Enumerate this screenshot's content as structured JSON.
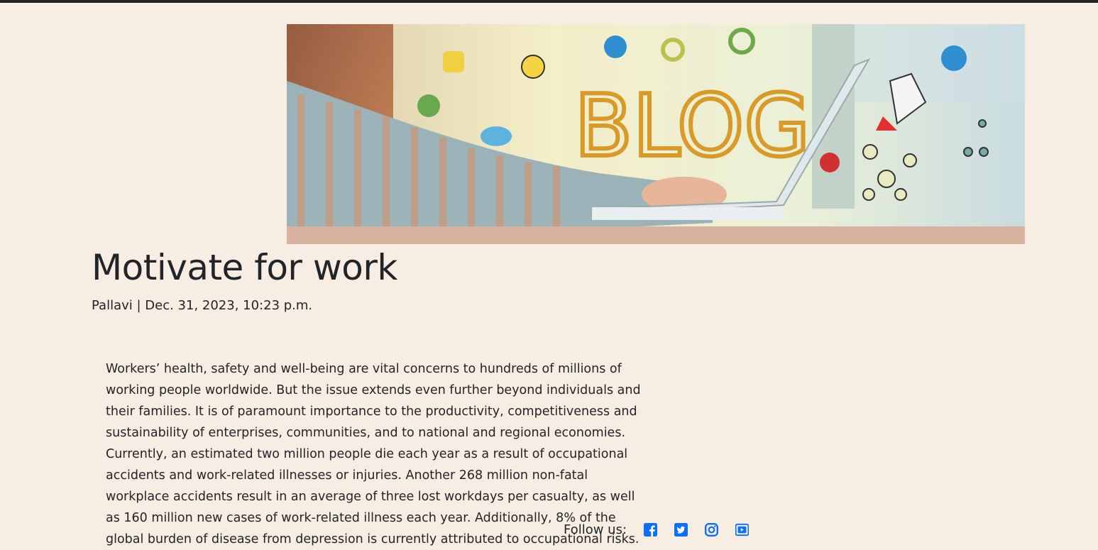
{
  "hero": {
    "image_alt": "Blog banner",
    "banner_text": "BLOG"
  },
  "post": {
    "title": "Motivate for work",
    "meta": "Pallavi | Dec. 31, 2023, 10:23 p.m.",
    "body": "Workers’ health, safety and well-being are vital concerns to hundreds of millions of working people worldwide. But the issue extends even further beyond individuals and their families. It is of paramount importance to the productivity, competitiveness and sustainability of enterprises, communities, and to national and regional economies. Currently, an estimated two million people die each year as a result of occupational accidents and work-related illnesses or injuries. Another 268 million non-fatal workplace accidents result in an average of three lost workdays per casualty, as well as 160 million new cases of work-related illness each year. Additionally, 8% of the global burden of disease from depression is currently attributed to occupational risks."
  },
  "footer": {
    "follow_label": "Follow us:",
    "social": [
      {
        "icon": "facebook-icon"
      },
      {
        "icon": "twitter-icon"
      },
      {
        "icon": "instagram-icon"
      },
      {
        "icon": "youtube-icon"
      }
    ]
  },
  "colors": {
    "background": "#f8ede2",
    "social_icon": "#0d6efd",
    "text": "#212529"
  }
}
